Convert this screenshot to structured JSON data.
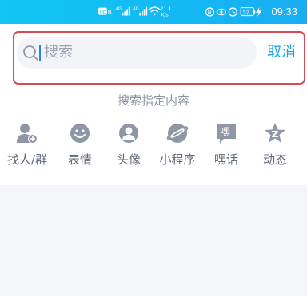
{
  "status_bar": {
    "speed_top": "21.1",
    "speed_bottom": "K/s",
    "battery": "52",
    "time": "09:33"
  },
  "search": {
    "placeholder": "搜索",
    "cancel_label": "取消"
  },
  "hint": "搜索指定内容",
  "categories": [
    {
      "label": "找人/群",
      "icon": "find-person-icon"
    },
    {
      "label": "表情",
      "icon": "emoji-icon"
    },
    {
      "label": "头像",
      "icon": "avatar-icon"
    },
    {
      "label": "小程序",
      "icon": "mini-program-icon"
    },
    {
      "label": "嘿话",
      "icon": "heihua-icon"
    },
    {
      "label": "动态",
      "icon": "moments-icon"
    }
  ],
  "colors": {
    "status_bar": "#14bbf2",
    "accent": "#18a4e2",
    "highlight": "#d84a55",
    "icon": "#8f97a6"
  }
}
